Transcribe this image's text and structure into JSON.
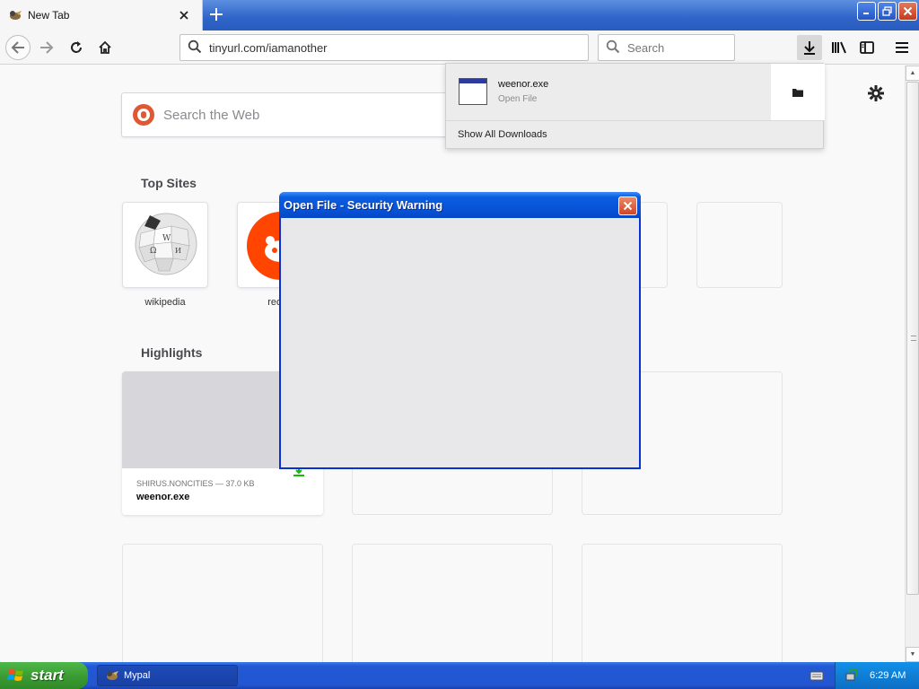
{
  "browser": {
    "tab": {
      "title": "New Tab"
    },
    "url": "tinyurl.com/iamanother",
    "search_placeholder": "Search"
  },
  "newtab": {
    "web_search_placeholder": "Search the Web",
    "top_sites_title": "Top Sites",
    "top_sites": [
      {
        "label": "wikipedia"
      },
      {
        "label": "reddit"
      }
    ],
    "highlights_title": "Highlights",
    "highlight_card": {
      "meta": "SHIRUS.NONCITIES — 37.0 KB",
      "title": "weenor.exe"
    }
  },
  "downloads_panel": {
    "item": {
      "name": "weenor.exe",
      "status": "Open File"
    },
    "show_all_label": "Show All Downloads"
  },
  "dialog": {
    "title": "Open File - Security Warning"
  },
  "taskbar": {
    "start_label": "start",
    "task_label": "Mypal",
    "clock": "6:29 AM"
  },
  "colors": {
    "xp_blue": "#0a5de0",
    "start_green": "#3c9d34",
    "reddit_orange": "#ff4500",
    "duckduckgo_orange": "#de5833"
  }
}
